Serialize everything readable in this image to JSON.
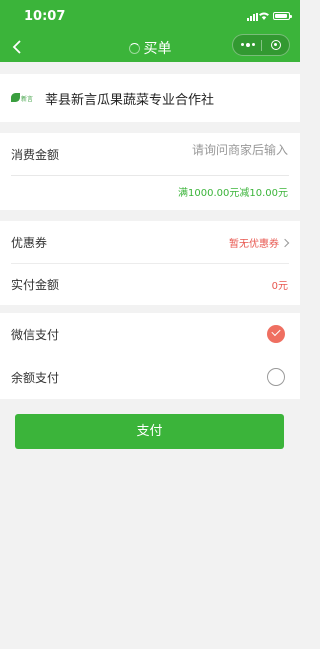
{
  "status_bar": {
    "time": "10:07"
  },
  "nav": {
    "back_icon": "chevron-left-icon",
    "title": "买单",
    "capsule_icons": [
      "more-dots-icon",
      "close-target-icon"
    ]
  },
  "merchant": {
    "logo_icon": "merchant-logo-icon",
    "logo_text": "新言",
    "name": "莘县新言瓜果蔬菜专业合作社"
  },
  "amount": {
    "label": "消费金额",
    "placeholder": "请询问商家后输入",
    "promotion": "满1000.00元减10.00元"
  },
  "coupon": {
    "label": "优惠券",
    "value": "暂无优惠券"
  },
  "actual": {
    "label": "实付金额",
    "value": "0元"
  },
  "payment": {
    "options": [
      {
        "label": "微信支付",
        "selected": true
      },
      {
        "label": "余额支付",
        "selected": false
      }
    ]
  },
  "submit": {
    "label": "支付"
  },
  "colors": {
    "brand": "#3bb43a",
    "accent_red": "#e8574f",
    "radio_selected": "#ef6f61",
    "background": "#f2f2f2"
  }
}
